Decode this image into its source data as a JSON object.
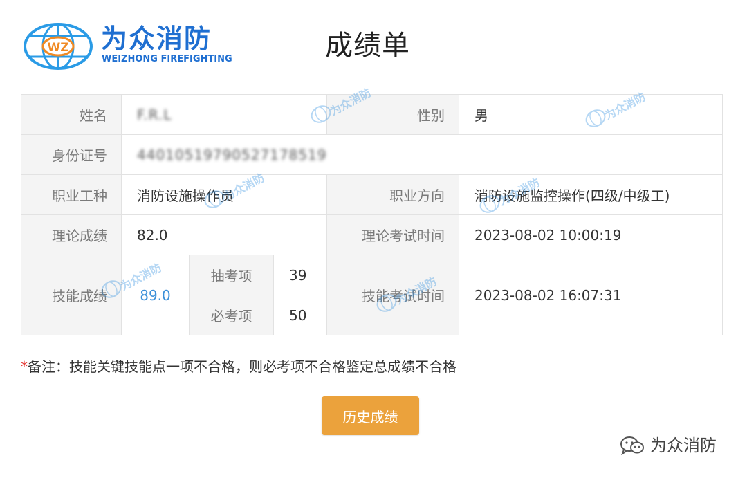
{
  "logo": {
    "badge_text": "WZ",
    "name_cn": "为众消防",
    "name_en": "WEIZHONG FIREFIGHTING",
    "icon": "globe-logo-icon"
  },
  "title": "成绩单",
  "fields": {
    "name_label": "姓名",
    "name_value": "F.R.L",
    "gender_label": "性别",
    "gender_value": "男",
    "id_label": "身份证号",
    "id_value": "44010519790527178519",
    "occupation_label": "职业工种",
    "occupation_value": "消防设施操作员",
    "direction_label": "职业方向",
    "direction_value": "消防设施监控操作(四级/中级工)",
    "theory_label": "理论成绩",
    "theory_value": "82.0",
    "theory_time_label": "理论考试时间",
    "theory_time_value": "2023-08-02 10:00:19",
    "skill_label": "技能成绩",
    "skill_value": "89.0",
    "draw_label": "抽考项",
    "draw_value": "39",
    "required_label": "必考项",
    "required_value": "50",
    "skill_time_label": "技能考试时间",
    "skill_time_value": "2023-08-02 16:07:31"
  },
  "note": {
    "marker": "*",
    "text": "备注：技能关键技能点一项不合格，则必考项不合格鉴定总成绩不合格"
  },
  "history_button_label": "历史成绩",
  "watermark_text": "为众消防",
  "footer": {
    "icon": "wechat-icon",
    "account_name": "为众消防"
  },
  "colors": {
    "brand_blue": "#1f6fd1",
    "skill_score_blue": "#3a8fd8",
    "button_orange": "#eba23c",
    "required_red": "#e53935",
    "label_bg": "#f4f4f4"
  }
}
